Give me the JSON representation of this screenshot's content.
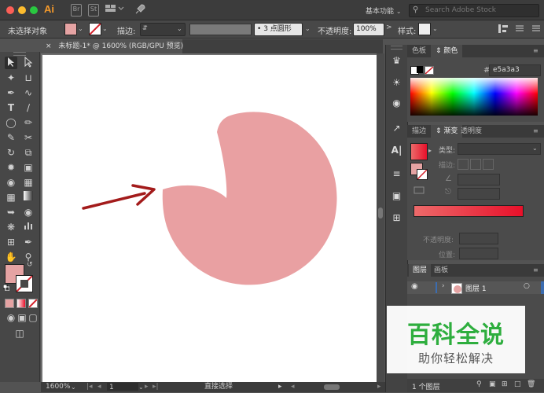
{
  "titlebar": {
    "app_logo": "Ai",
    "br_icon": "Br",
    "st_icon": "St",
    "workspace_label": "基本功能",
    "search_placeholder": "Search Adobe Stock"
  },
  "controlbar": {
    "selection_label": "未选择对象",
    "stroke_label": "描边:",
    "stroke_style_label": "3 点圆形",
    "opacity_label": "不透明度:",
    "opacity_value": "100%",
    "style_label": "样式:"
  },
  "document": {
    "tab_title": "未标题-1* @ 1600% (RGB/GPU 预览)",
    "close_glyph": "×"
  },
  "status": {
    "zoom": "1600%",
    "page": "1",
    "tool": "直接选择"
  },
  "color_panel": {
    "tab_swatches": "色板",
    "tab_color": "颜色",
    "hex_prefix": "#",
    "hex_value": "e5a3a3"
  },
  "gradient_panel": {
    "tab_stroke": "描边",
    "tab_gradient": "渐变",
    "tab_transparency": "透明度",
    "type_label": "类型:",
    "stroke_label": "描边:",
    "opacity_label": "不透明度:",
    "position_label": "位置:"
  },
  "layers_panel": {
    "tab_layers": "图层",
    "tab_artboards": "画板",
    "layer_name": "图层 1",
    "footer_count": "1 个图层"
  },
  "watermark": {
    "title": "百科全说",
    "subtitle": "助你轻松解决"
  },
  "colors": {
    "fill": "#e5a3a3",
    "arrow": "#a31b1b",
    "gradient_start": "#ed6a6a",
    "gradient_end": "#e8102a",
    "watermark_green": "#2eae3e",
    "layer_highlight": "#3b6cb0"
  }
}
